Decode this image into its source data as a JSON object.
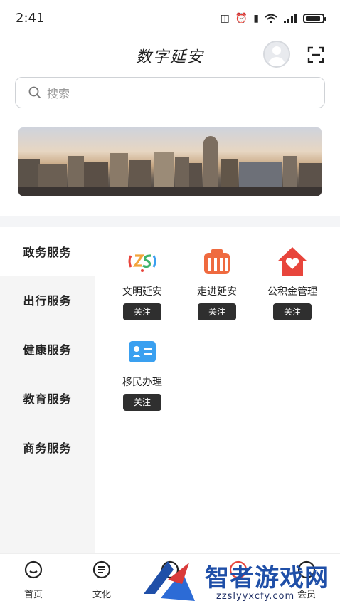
{
  "status_bar": {
    "time": "2:41"
  },
  "header": {
    "title": "数字延安"
  },
  "search": {
    "placeholder": "搜索"
  },
  "sidebar": {
    "items": [
      {
        "label": "政务服务",
        "active": true
      },
      {
        "label": "出行服务",
        "active": false
      },
      {
        "label": "健康服务",
        "active": false
      },
      {
        "label": "教育服务",
        "active": false
      },
      {
        "label": "商务服务",
        "active": false
      }
    ]
  },
  "services": [
    {
      "name": "文明延安",
      "icon": "wenming-logo-icon",
      "follow_label": "关注"
    },
    {
      "name": "走进延安",
      "icon": "building-icon",
      "follow_label": "关注"
    },
    {
      "name": "公积金管理",
      "icon": "house-heart-icon",
      "follow_label": "关注"
    },
    {
      "name": "移民办理",
      "icon": "id-card-icon",
      "follow_label": "关注"
    }
  ],
  "tabbar": {
    "items": [
      {
        "label": "首页",
        "icon": "home-icon"
      },
      {
        "label": "文化",
        "icon": "document-icon"
      },
      {
        "label": "",
        "icon": "chat-icon"
      },
      {
        "label": "",
        "icon": "service-icon"
      },
      {
        "label": "会员",
        "icon": "member-icon"
      }
    ]
  },
  "watermark": {
    "title": "智者游戏网",
    "url": "zzslyyxcfy.com"
  },
  "colors": {
    "accent_red": "#e8453c",
    "accent_blue": "#3aa0f0",
    "follow_bg": "#2f2f2f",
    "sidebar_bg": "#f5f5f5"
  }
}
